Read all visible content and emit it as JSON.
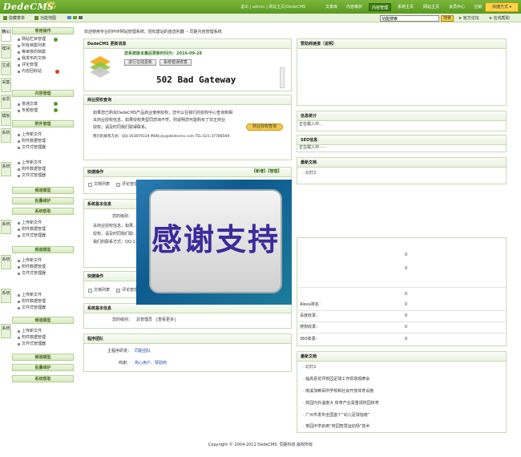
{
  "app": {
    "logo": "DedeCMS",
    "version_line1": "SP2",
    "version_line2": "v5.7",
    "user_links": "退出 | admin | 网站主页/DedeCMS",
    "quick": "快捷方式 ▾"
  },
  "topnav": [
    "文章库",
    "内容维护",
    "内容管理",
    "系统主页",
    "网站主页",
    "会员中心",
    "注销"
  ],
  "subbar": {
    "left1": "隐藏菜单",
    "left2": "功能地图",
    "search_value": "功能搜索",
    "search_btn": "搜索",
    "forum": "官方论坛",
    "help": "在线帮助"
  },
  "vtabs": [
    "核心",
    "模块",
    "生成",
    "采集",
    "会员",
    "模板",
    "系统",
    "系统",
    "系统",
    "系统",
    "系统",
    "系统"
  ],
  "side": {
    "sec1": "常用操作",
    "sec1_items": [
      "网站栏目管理",
      "所有档案列表",
      "等审核的档案",
      "我发布的文档",
      "评论管理",
      "内容回收站"
    ],
    "sec2": "内容管理",
    "sec2_items": [
      "普通文章",
      "专题管理"
    ],
    "sec3": "附件管理",
    "sec3_items": [
      "上传新文件",
      "附件数据管理",
      "文件式管理器"
    ],
    "sec4": "频道模型",
    "sec5": "批量维护",
    "sec6": "系统帮助",
    "sec6_items": [
      "上传新文件",
      "附件数据管理",
      "文件式管理器"
    ],
    "sec7": "频道模型",
    "sec7_items": [
      "上传新文件",
      "附件数据管理",
      "文件式管理器"
    ],
    "sec8_items": [
      "上传新文件",
      "附件数据管理",
      "文件式管理器"
    ],
    "sec9": "频道模型",
    "sec9_items": [
      "上传新文件",
      "附件数据管理",
      "文件式管理器"
    ],
    "sec10": "频道模型",
    "sec11": "批量维护",
    "sec12": "系统帮助"
  },
  "main": {
    "welcome": "欢迎使用专业的PHP网站管理系统，轻松建站的首选利器 -- 同距内容管理系统",
    "update_title": "DedeCMS 更新消息",
    "update_date": "您系统版本最后更新时间为：2016-09-28",
    "btn_update": "进行在线更新",
    "btn_patch": "系统错误修复",
    "error": "502 Bad Gateway",
    "auth_title": "商业授权查询",
    "auth_lines": [
      "如果您已购买DedeCMS产品商业使用授权，您可以在我们的授权中心查询到相",
      "关商业授权信息，如果授权类型同您询不符，则说明您可能购买了非正商业",
      "授权，请及时同我们取得联系。",
      "我们的联系方式：QQ:163879319 MSN:joy@dedecms.com TEL:021-37788569"
    ],
    "auth_btn": "商业授权查询",
    "quick_title": "快捷操作",
    "quick_links": "【新增】【管理】",
    "q1": "文档列表",
    "q2": "评论管理",
    "sys_title": "系统基本信息",
    "sys_line1": "您的级别：",
    "sys_lines": [
      "关商业授权信息，如果...",
      "授权，请及时同我们取...",
      "我们的联系方式：QQ:1..."
    ],
    "quick2_title": "快捷操作",
    "q3": "文档列表",
    "q4": "评论管理",
    "sys2_title": "系统基本信息",
    "level_label": "您的级别：",
    "level_value": "总管理员",
    "level_more": "[查看更多]",
    "team_title": "程序团队",
    "dev_label": "主程序研发：",
    "dev_value": "同距团队",
    "thanks_label": "鸣谢：",
    "thanks_value": "热心用户、赞助商"
  },
  "right": {
    "sponsor_title": "赞助商链接（说明）",
    "stats_title": "信息统计",
    "loading1": "正在载入中...",
    "seo_title": "SEO信息",
    "loading2": "正在载入中······",
    "latest_title": "最新文档",
    "latest_first": "· 幻灯2",
    "seo_rows": [
      {
        "label": "Alexa排名：",
        "value": "0"
      },
      {
        "label": "百度收录：",
        "value": "0"
      },
      {
        "label": "搜狗收录：",
        "value": "0"
      },
      {
        "label": "360收录：",
        "value": "0"
      }
    ],
    "zeros": [
      "0",
      "0",
      "0"
    ],
    "latest2_title": "最新文档",
    "latest2": [
      "· 幻灯2",
      "· 临高县花坪校园足球工作现场观摩会",
      "· 南溪加嘛百所学校和社会开放体育设施",
      "· 校园内外温度大  体育产业需重视校园体育",
      "· 广州市发布全国首个“幼儿足球指南”",
      "· 萃园中学启用“校园智慧运动场”技术"
    ]
  },
  "overlay": {
    "text": "感谢支持"
  },
  "footer": "Copyright © 2004-2011 DedeCMS. 同距科技 版权所有"
}
